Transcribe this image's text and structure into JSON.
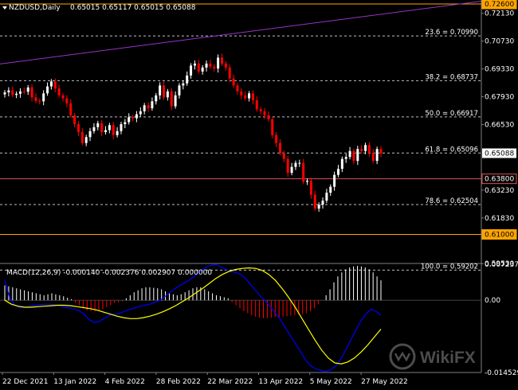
{
  "header": {
    "symbol": "NZDUSD,Daily",
    "ohlc": "0.65015 0.65117 0.65015 0.65088"
  },
  "macd_header": "MACD(12,26,9) -0.000140 -0.002376 0.002907 0.000000",
  "watermark": "WikiFX",
  "colors": {
    "background": "#000000",
    "bull": "#ffffff",
    "bear": "#ff0000",
    "orange_level": "#ffa500",
    "violet_trend": "#9932cc",
    "macd_line": "#0000ff",
    "signal_line": "#ffff00",
    "grid": "#c0c0c0"
  },
  "chart_data": [
    {
      "type": "candlestick",
      "ylim": [
        0.5954,
        0.728
      ],
      "price_ticks": [
        "0.72130",
        "0.70730",
        "0.69330",
        "0.67930",
        "0.66530",
        "0.63230",
        "0.61830",
        "0.59530"
      ],
      "x_labels": [
        "22 Dec 2021",
        "13 Jan 2022",
        "4 Feb 2022",
        "28 Feb 2022",
        "22 Mar 2022",
        "13 Apr 2022",
        "5 May 2022",
        "27 May 2022"
      ],
      "level_boxes": [
        {
          "label": "0.72600",
          "value": 0.726,
          "style": "orange"
        },
        {
          "label": "0.63800",
          "value": 0.638,
          "style": "red"
        },
        {
          "label": "0.61000",
          "value": 0.61,
          "style": "orange"
        }
      ],
      "current_price": {
        "label": "0.65088",
        "value": 0.65088
      },
      "fibonacci": [
        {
          "label": "23.6 = 0.70990",
          "value": 0.7099
        },
        {
          "label": "38.2 = 0.68737",
          "value": 0.68737
        },
        {
          "label": "50.0 = 0.66917",
          "value": 0.66917
        },
        {
          "label": "61.8 = 0.65096",
          "value": 0.65096
        },
        {
          "label": "78.6 = 0.62504",
          "value": 0.62504
        },
        {
          "label": "100.0 = 0.59202",
          "value": 0.59202
        }
      ],
      "trendline": {
        "from": 0.6958,
        "to": 0.7274
      },
      "closes": [
        0.6815,
        0.6825,
        0.6802,
        0.6808,
        0.682,
        0.6818,
        0.684,
        0.679,
        0.6772,
        0.677,
        0.681,
        0.6845,
        0.687,
        0.6835,
        0.68,
        0.6785,
        0.676,
        0.67,
        0.6655,
        0.6615,
        0.656,
        0.659,
        0.662,
        0.664,
        0.666,
        0.6615,
        0.6625,
        0.665,
        0.66,
        0.662,
        0.6655,
        0.6665,
        0.669,
        0.6685,
        0.6705,
        0.672,
        0.675,
        0.6735,
        0.677,
        0.68,
        0.685,
        0.679,
        0.682,
        0.6745,
        0.68,
        0.685,
        0.686,
        0.69,
        0.695,
        0.696,
        0.692,
        0.694,
        0.696,
        0.6945,
        0.6935,
        0.699,
        0.696,
        0.694,
        0.6885,
        0.685,
        0.682,
        0.68,
        0.6785,
        0.681,
        0.6775,
        0.673,
        0.672,
        0.67,
        0.668,
        0.66,
        0.656,
        0.651,
        0.648,
        0.641,
        0.644,
        0.646,
        0.646,
        0.6365,
        0.637,
        0.63,
        0.623,
        0.625,
        0.627,
        0.631,
        0.634,
        0.64,
        0.643,
        0.648,
        0.649,
        0.652,
        0.647,
        0.653,
        0.652,
        0.655,
        0.651,
        0.647,
        0.653,
        0.6509
      ]
    },
    {
      "type": "macd",
      "ylim": [
        -0.014529,
        0.007237
      ],
      "ticks": [
        "0.007237",
        "0.00",
        "-0.014529"
      ],
      "params": "12,26,9",
      "histogram": [
        0.003,
        0.0028,
        0.0026,
        0.0024,
        0.0022,
        0.002,
        0.0018,
        0.0016,
        0.0014,
        0.0012,
        0.001,
        0.0012,
        0.0014,
        0.0012,
        0.001,
        0.0008,
        0.0005,
        0.0002,
        -0.0005,
        -0.001,
        -0.0015,
        -0.002,
        -0.0022,
        -0.0022,
        -0.002,
        -0.0018,
        -0.0014,
        -0.001,
        -0.0006,
        -0.0004,
        -0.0002,
        0.0004,
        0.001,
        0.0016,
        0.002,
        0.0024,
        0.0026,
        0.0026,
        0.0025,
        0.0024,
        0.0022,
        0.0018,
        0.0015,
        0.0012,
        0.001,
        0.0012,
        0.0016,
        0.002,
        0.0024,
        0.0026,
        0.0026,
        0.0022,
        0.0018,
        0.0014,
        0.001,
        0.0008,
        0.0006,
        0.0004,
        -0.0004,
        -0.001,
        -0.0016,
        -0.0022,
        -0.0026,
        -0.003,
        -0.0033,
        -0.0035,
        -0.0036,
        -0.0036,
        -0.0035,
        -0.0034,
        -0.0034,
        -0.0033,
        -0.0032,
        -0.0031,
        -0.003,
        -0.0029,
        -0.0028,
        -0.0026,
        -0.0022,
        -0.0016,
        -0.0008,
        0.0,
        0.001,
        0.0022,
        0.0036,
        0.0048,
        0.0056,
        0.0062,
        0.0066,
        0.0068,
        0.0069,
        0.0068,
        0.0066,
        0.0062,
        0.0056,
        0.0048,
        0.004
      ],
      "macd": [
        0.004,
        0.0005,
        -0.001,
        -0.0015,
        -0.0014,
        -0.0012,
        -0.001,
        -0.0009,
        -0.0008,
        -0.0008,
        -0.0009,
        -0.0011,
        -0.0014,
        -0.0016,
        -0.0018,
        -0.0022,
        -0.003,
        -0.004,
        -0.0045,
        -0.0042,
        -0.0035,
        -0.003,
        -0.0028,
        -0.0026,
        -0.0022,
        -0.0018,
        -0.0015,
        -0.0012,
        -0.001,
        -0.0008,
        -0.0004,
        0.0,
        0.0008,
        0.0016,
        0.0024,
        0.003,
        0.0036,
        0.0042,
        0.005,
        0.0058,
        0.0066,
        0.007,
        0.0072,
        0.0068,
        0.0062,
        0.0058,
        0.0056,
        0.0052,
        0.0044,
        0.0032,
        0.002,
        0.0008,
        -0.0002,
        -0.0014,
        -0.0026,
        -0.004,
        -0.0056,
        -0.0072,
        -0.0088,
        -0.0104,
        -0.012,
        -0.0132,
        -0.0138,
        -0.0141,
        -0.0143,
        -0.014,
        -0.0132,
        -0.0118,
        -0.01,
        -0.008,
        -0.006,
        -0.0042,
        -0.0028,
        -0.0018,
        -0.0022,
        -0.003
      ],
      "signal": [
        0.0,
        -0.0008,
        -0.0012,
        -0.0014,
        -0.0014,
        -0.0013,
        -0.0012,
        -0.0011,
        -0.001,
        -0.001,
        -0.0011,
        -0.0013,
        -0.0015,
        -0.0017,
        -0.002,
        -0.0024,
        -0.0028,
        -0.0032,
        -0.0035,
        -0.0037,
        -0.0037,
        -0.0035,
        -0.0032,
        -0.0028,
        -0.0023,
        -0.0017,
        -0.001,
        -0.0002,
        0.0006,
        0.0015,
        0.0024,
        0.0034,
        0.0044,
        0.0052,
        0.0058,
        0.0062,
        0.0064,
        0.0065,
        0.0064,
        0.006,
        0.0052,
        0.004,
        0.0024,
        0.0006,
        -0.0014,
        -0.0036,
        -0.0058,
        -0.008,
        -0.01,
        -0.0116,
        -0.0126,
        -0.0128,
        -0.0124,
        -0.0116,
        -0.0104,
        -0.009,
        -0.0074,
        -0.0058
      ]
    }
  ]
}
